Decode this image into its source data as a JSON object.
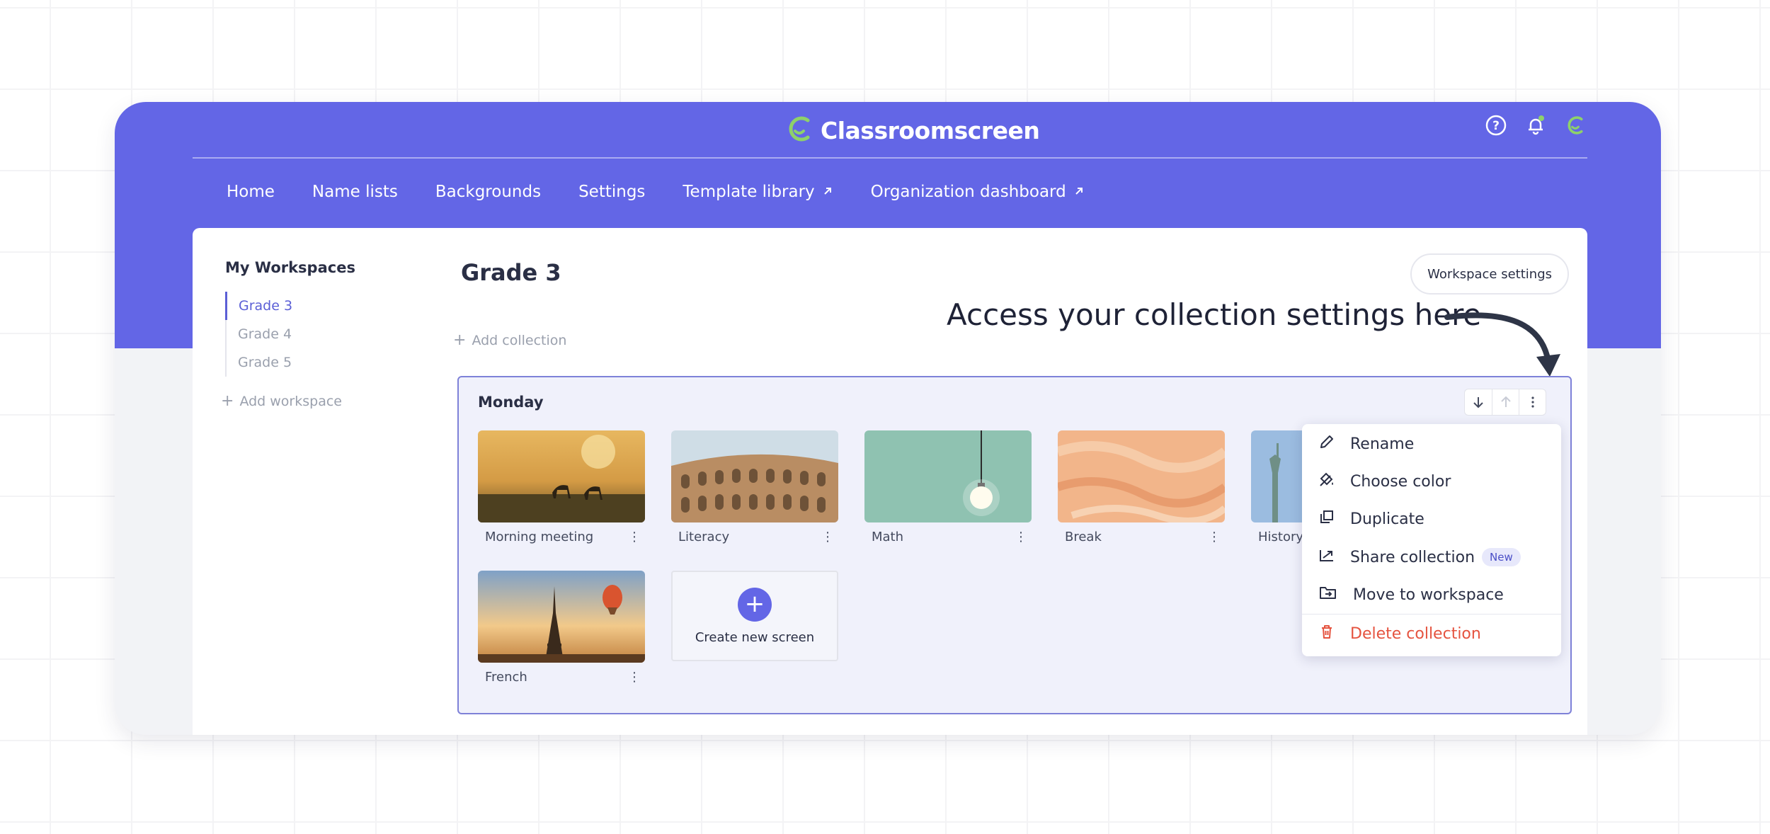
{
  "app": {
    "name": "Classroomscreen",
    "brand_color": "#6366e6",
    "accent_green": "#8ed16a"
  },
  "header": {
    "icons": [
      "help-icon",
      "bell-icon",
      "profile-logo-icon"
    ],
    "nav": [
      {
        "label": "Home",
        "external": false
      },
      {
        "label": "Name lists",
        "external": false
      },
      {
        "label": "Backgrounds",
        "external": false
      },
      {
        "label": "Settings",
        "external": false
      },
      {
        "label": "Template library",
        "external": true
      },
      {
        "label": "Organization dashboard",
        "external": true
      }
    ]
  },
  "sidebar": {
    "title": "My Workspaces",
    "workspaces": [
      {
        "label": "Grade 3",
        "active": true
      },
      {
        "label": "Grade 4",
        "active": false
      },
      {
        "label": "Grade 5",
        "active": false
      }
    ],
    "add_workspace": "Add workspace"
  },
  "main": {
    "title": "Grade 3",
    "workspace_settings": "Workspace settings",
    "add_collection": "Add collection"
  },
  "callout": "Access your collection settings here",
  "collection": {
    "title": "Monday",
    "screens": [
      {
        "label": "Morning meeting"
      },
      {
        "label": "Literacy"
      },
      {
        "label": "Math"
      },
      {
        "label": "Break"
      },
      {
        "label": "History"
      },
      {
        "label": "French"
      }
    ],
    "create_new": "Create new screen"
  },
  "menu": {
    "items": [
      {
        "label": "Rename",
        "icon": "pencil-icon"
      },
      {
        "label": "Choose color",
        "icon": "paint-bucket-icon"
      },
      {
        "label": "Duplicate",
        "icon": "duplicate-icon"
      },
      {
        "label": "Share collection",
        "icon": "share-icon",
        "badge": "New"
      },
      {
        "label": "Move to workspace",
        "icon": "folder-move-icon"
      },
      {
        "label": "Delete collection",
        "icon": "trash-icon",
        "danger": true
      }
    ]
  }
}
